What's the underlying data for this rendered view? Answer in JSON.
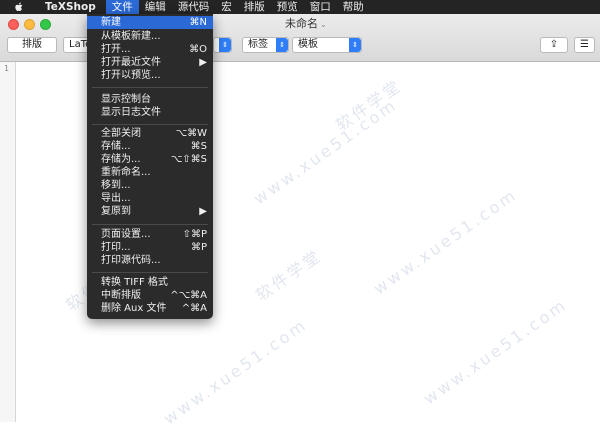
{
  "menubar": {
    "items": [
      "TeXShop",
      "文件",
      "编辑",
      "源代码",
      "宏",
      "排版",
      "预览",
      "窗口",
      "帮助"
    ]
  },
  "window": {
    "title": "未命名",
    "title_chevron": "⌄"
  },
  "toolbar": {
    "typeset_label": "排版",
    "latex_value": "LaTe",
    "label_value": "标签",
    "template_value": "模板",
    "share_icon": "⇪",
    "sidebar_icon": "☰"
  },
  "editor": {
    "line_number": "1"
  },
  "watermark": {
    "text_cn": "软件学堂",
    "text_url": "www.xue51.com"
  },
  "file_menu": {
    "items": [
      {
        "label": "新建",
        "shortcut": "⌘N",
        "highlighted": true
      },
      {
        "label": "从模板新建...",
        "shortcut": ""
      },
      {
        "label": "打开...",
        "shortcut": "⌘O"
      },
      {
        "label": "打开最近文件",
        "shortcut": "▶"
      },
      {
        "label": "打开以预览...",
        "shortcut": ""
      },
      {
        "label": "显示控制台",
        "shortcut": ""
      },
      {
        "label": "显示日志文件",
        "shortcut": ""
      },
      {
        "label": "全部关闭",
        "shortcut": "⌥⌘W"
      },
      {
        "label": "存储...",
        "shortcut": "⌘S"
      },
      {
        "label": "存储为...",
        "shortcut": "⌥⇧⌘S"
      },
      {
        "label": "重新命名...",
        "shortcut": ""
      },
      {
        "label": "移到...",
        "shortcut": ""
      },
      {
        "label": "导出...",
        "shortcut": ""
      },
      {
        "label": "复原到",
        "shortcut": "▶"
      },
      {
        "label": "页面设置...",
        "shortcut": "⇧⌘P"
      },
      {
        "label": "打印...",
        "shortcut": "⌘P"
      },
      {
        "label": "打印源代码...",
        "shortcut": ""
      },
      {
        "label": "转换 TIFF 格式",
        "shortcut": ""
      },
      {
        "label": "中断排版",
        "shortcut": "^⌥⌘A"
      },
      {
        "label": "删除 Aux 文件",
        "shortcut": "^⌘A"
      }
    ]
  }
}
